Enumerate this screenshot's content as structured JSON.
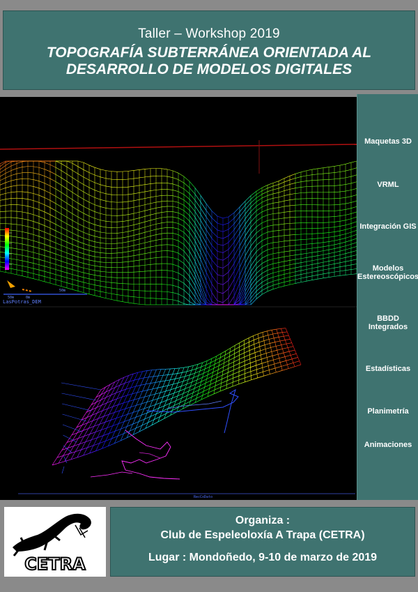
{
  "header": {
    "subtitle": "Taller – Workshop 2019",
    "title_line1": "TOPOGRAFÍA SUBTERRÁNEA ORIENTADA AL",
    "title_line2": "DESARROLLO DE MODELOS DIGITALES"
  },
  "visual": {
    "dem_label": "LasPotras_DEM",
    "scale_a": "50m",
    "scale_b": "0m",
    "scale_c": "50m",
    "bottom_label": "RecCoDato"
  },
  "sidebar": {
    "items": [
      {
        "label": "Maquetas 3D"
      },
      {
        "label": "VRML"
      },
      {
        "label": "Integración GIS"
      },
      {
        "label_line1": "Modelos",
        "label_line2": "Estereoscópicos"
      },
      {
        "label_line1": "BBDD",
        "label_line2": "Integrados"
      },
      {
        "label": "Estadísticas"
      },
      {
        "label": "Planimetría"
      },
      {
        "label": "Animaciones"
      }
    ]
  },
  "logo": {
    "text": "CETRA"
  },
  "footer": {
    "organiza": "Organiza :",
    "org_name": "Club de Espeleoloxía A Trapa (CETRA)",
    "place": "Lugar : Mondoñedo, 9-10 de marzo de 2019"
  },
  "colors": {
    "panel": "#3f7370",
    "page_bg": "#8a8a8a",
    "visual_bg": "#000000"
  }
}
